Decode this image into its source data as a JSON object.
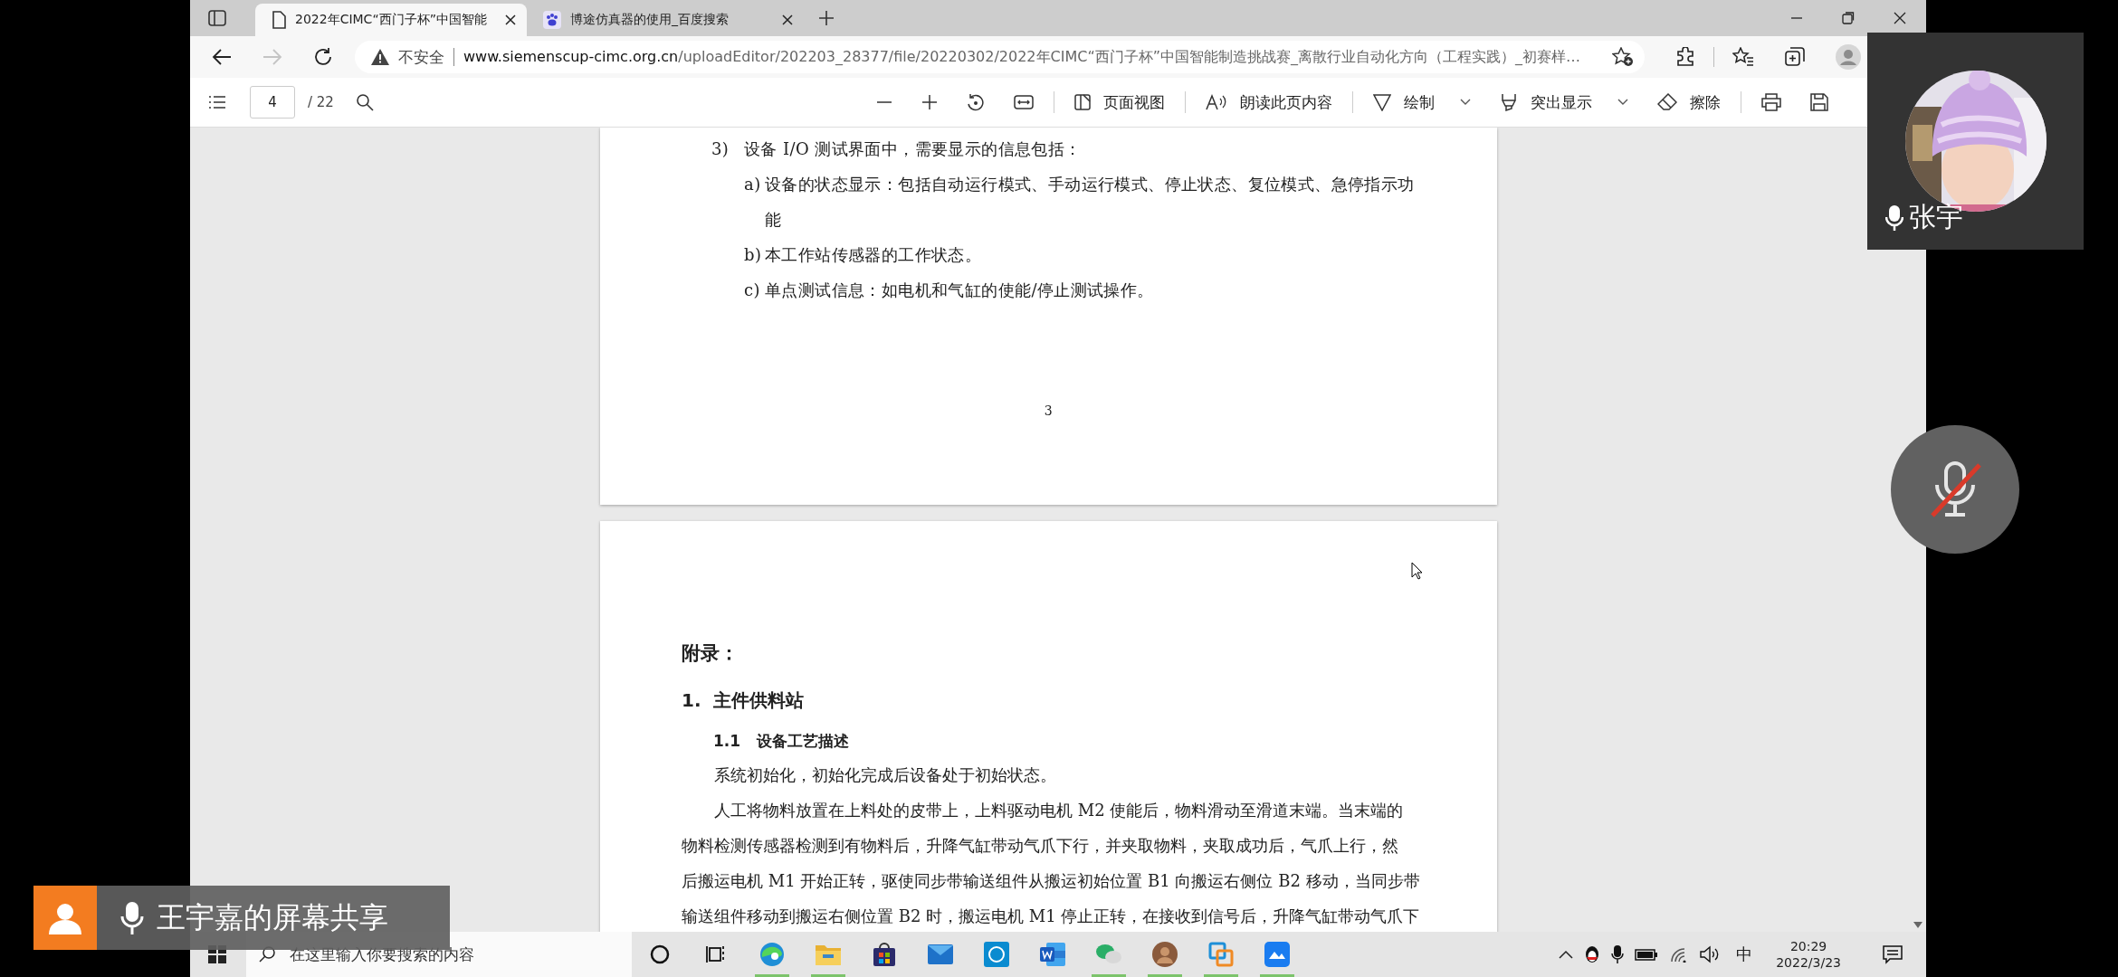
{
  "browser": {
    "tabs": [
      {
        "title": "2022年CIMC“西门子杯”中国智能",
        "selected": true
      },
      {
        "title": "博途仿真器的使用_百度搜索",
        "selected": false
      }
    ],
    "address": {
      "security": "不安全",
      "host": "www.siemenscup-cimc.org.cn",
      "path": "/uploadEditor/202203_28377/file/20220302/2022年CIMC“西门子杯”中国智能制造挑战赛_离散行业自动化方向（工程实践）_初赛样…"
    }
  },
  "pdf_toolbar": {
    "page": "4",
    "total": "/ 22",
    "tools": [
      {
        "kind": "page-view",
        "label": "页面视图",
        "menu": false
      },
      {
        "kind": "read-aloud",
        "label": "朗读此页内容",
        "menu": false
      },
      {
        "kind": "draw",
        "label": "绘制",
        "menu": true
      },
      {
        "kind": "highlight",
        "label": "突出显示",
        "menu": true
      },
      {
        "kind": "erase",
        "label": "擦除",
        "menu": false
      }
    ]
  },
  "document": {
    "page_1": {
      "items": [
        {
          "marker": "3)",
          "text": "设备 I/O 测试界面中，需要显示的信息包括：",
          "children": [
            {
              "marker": "a)",
              "text": "设备的状态显示：包括自动运行模式、手动运行模式、停止状态、复位模式、急停指示功能"
            },
            {
              "marker": "b)",
              "text": "本工作站传感器的工作状态。"
            },
            {
              "marker": "c)",
              "text": "单点测试信息：如电机和气缸的使能/停止测试操作。"
            }
          ]
        }
      ],
      "page_number": "3"
    },
    "page_2": {
      "heading": "附录：",
      "section": {
        "number": "1.",
        "title": "主件供料站"
      },
      "subsection": {
        "number": "1.1",
        "title": "设备工艺描述"
      },
      "paragraphs": [
        [
          "系统初始化，初始化完成后设备处于初始状态。"
        ],
        [
          "人工将物料放置在上料处的皮带上，上料驱动电机 M2 使能后，物料滑动至滑道末端。当末端的",
          "物料检测传感器检测到有物料后，升降气缸带动气爪下行，并夹取物料，夹取成功后，气爪上行，然",
          "后搬运电机 M1 开始正转，驱使同步带输送组件从搬运初始位置 B1 向搬运右侧位 B2 移动，当同步带",
          "输送组件移动到搬运右侧位置 B2 时，搬运电机 M1 停止正转，在接收到信号后，升降气缸带动气爪下"
        ]
      ]
    }
  },
  "meeting": {
    "participant": {
      "name": "张宇"
    },
    "share_banner": "王宇嘉的屏幕共享"
  },
  "taskbar": {
    "search_placeholder": "在这里输入你要搜索的内容",
    "apps": [
      {
        "kind": "cortana",
        "running": false
      },
      {
        "kind": "task-view",
        "running": false
      },
      {
        "kind": "edge",
        "running": true
      },
      {
        "kind": "folder",
        "running": true
      },
      {
        "kind": "store",
        "running": false
      },
      {
        "kind": "mail",
        "running": false
      },
      {
        "kind": "dell",
        "running": false
      },
      {
        "kind": "word",
        "running": false
      },
      {
        "kind": "wechat",
        "running": true
      },
      {
        "kind": "avatar",
        "running": true
      },
      {
        "kind": "vm",
        "running": true
      },
      {
        "kind": "feishu",
        "running": true
      }
    ],
    "ime": "中",
    "time": "20:29",
    "date": "2022/3/23"
  }
}
